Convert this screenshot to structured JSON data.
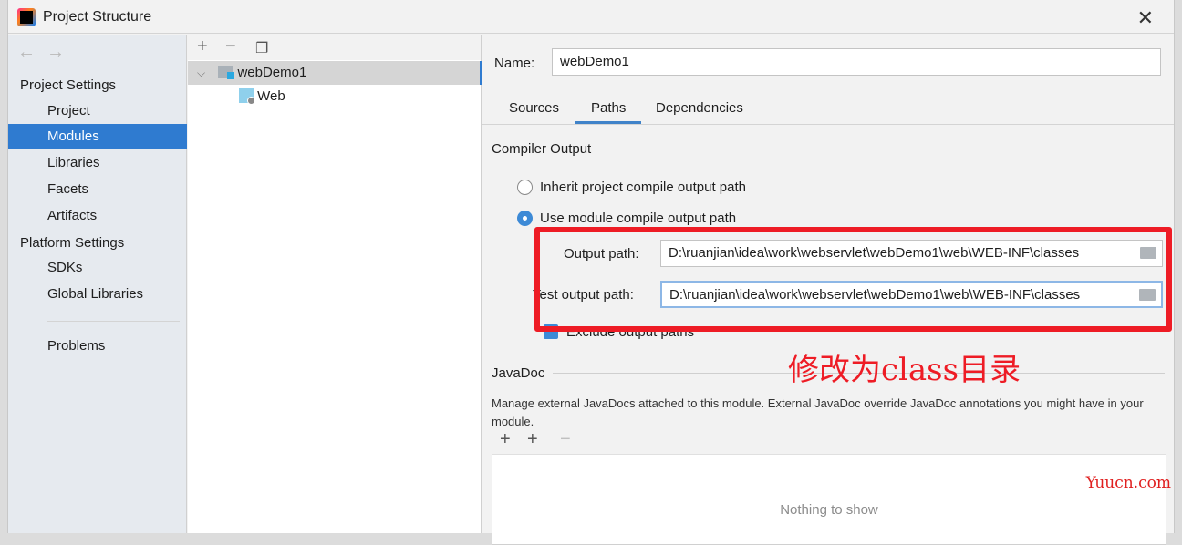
{
  "window": {
    "title": "Project Structure"
  },
  "sidebar": {
    "items": [
      {
        "label": "Project Settings",
        "header": true
      },
      {
        "label": "Project"
      },
      {
        "label": "Modules",
        "selected": true
      },
      {
        "label": "Libraries"
      },
      {
        "label": "Facets"
      },
      {
        "label": "Artifacts"
      },
      {
        "label": "Platform Settings",
        "header": true
      },
      {
        "label": "SDKs"
      },
      {
        "label": "Global Libraries"
      },
      {
        "label": "Problems"
      }
    ]
  },
  "tree": {
    "nodes": [
      {
        "label": "webDemo1",
        "selected": true
      },
      {
        "label": "Web"
      }
    ]
  },
  "main": {
    "name_label": "Name:",
    "name_value": "webDemo1",
    "tabs": [
      {
        "label": "Sources"
      },
      {
        "label": "Paths",
        "active": true
      },
      {
        "label": "Dependencies"
      }
    ],
    "compiler_output": "Compiler Output",
    "radio_inherit": "Inherit project compile output path",
    "radio_module": "Use module compile output path",
    "output_label": "Output path:",
    "output_value": "D:\\ruanjian\\idea\\work\\webservlet\\webDemo1\\web\\WEB-INF\\classes",
    "test_label": "Test output path:",
    "test_value": "D:\\ruanjian\\idea\\work\\webservlet\\webDemo1\\web\\WEB-INF\\classes",
    "exclude_label": "Exclude output paths",
    "javadoc": "JavaDoc",
    "javadoc_desc": "Manage external JavaDocs attached to this module. External JavaDoc override JavaDoc annotations you might have in your module.",
    "empty": "Nothing to show"
  },
  "annotation": "修改为class目录",
  "watermark": "Yuucn.com",
  "colors": {
    "accent": "#2f7bd0",
    "annotation": "#ee1c25"
  }
}
